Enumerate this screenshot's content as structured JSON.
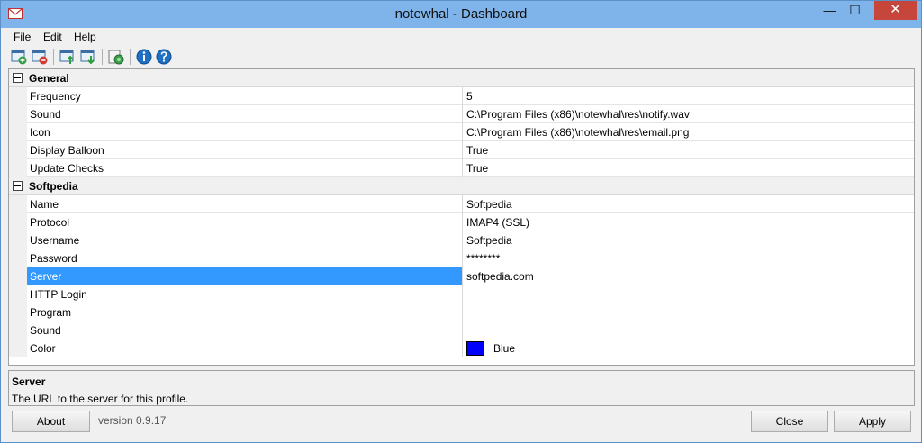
{
  "window": {
    "title": "notewhal - Dashboard",
    "close_glyph": "✕",
    "minimize_glyph": "—",
    "maximize_glyph": "☐"
  },
  "menu": {
    "items": [
      "File",
      "Edit",
      "Help"
    ]
  },
  "toolbar": {
    "buttons": [
      {
        "icon": "add-profile-icon"
      },
      {
        "icon": "remove-profile-icon"
      },
      {
        "icon": "move-up-icon"
      },
      {
        "icon": "move-down-icon"
      },
      {
        "icon": "check-mail-icon"
      },
      {
        "icon": "info-icon"
      },
      {
        "icon": "help-icon"
      }
    ]
  },
  "grid": {
    "categories": [
      {
        "label": "General",
        "properties": [
          {
            "name": "Frequency",
            "value": "5"
          },
          {
            "name": "Sound",
            "value": "C:\\Program Files (x86)\\notewhal\\res\\notify.wav"
          },
          {
            "name": "Icon",
            "value": "C:\\Program Files (x86)\\notewhal\\res\\email.png"
          },
          {
            "name": "Display Balloon",
            "value": "True"
          },
          {
            "name": "Update Checks",
            "value": "True"
          }
        ]
      },
      {
        "label": "Softpedia",
        "properties": [
          {
            "name": "Name",
            "value": "Softpedia"
          },
          {
            "name": "Protocol",
            "value": "IMAP4 (SSL)"
          },
          {
            "name": "Username",
            "value": "Softpedia"
          },
          {
            "name": "Password",
            "value": "********"
          },
          {
            "name": "Server",
            "value": "softpedia.com"
          },
          {
            "name": "HTTP Login",
            "value": ""
          },
          {
            "name": "Program",
            "value": ""
          },
          {
            "name": "Sound",
            "value": ""
          },
          {
            "name": "Color",
            "value": "Blue"
          }
        ]
      }
    ],
    "selected_property": "Server",
    "color_swatch": "#0000ff"
  },
  "help": {
    "title": "Server",
    "description": "The URL to the server for this profile."
  },
  "footer": {
    "about_label": "About",
    "version": "version 0.9.17",
    "close_label": "Close",
    "apply_label": "Apply"
  },
  "colors": {
    "selection": "#3399ff",
    "titlebar": "#7eb4ea",
    "close_button": "#c7463c"
  }
}
